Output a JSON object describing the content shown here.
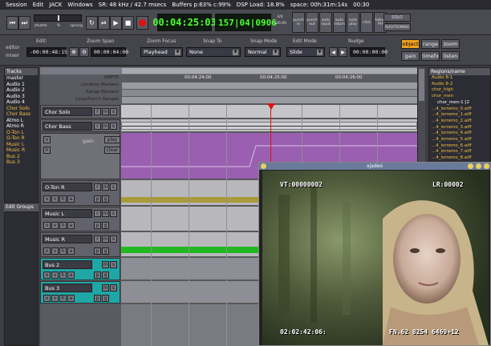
{
  "menu": [
    "Session",
    "Edit",
    "JACK",
    "Windows",
    "SR: 48 kHz / 42.7 msecs",
    "Buffers p:63% c:99%",
    "DSP Load: 18.8%",
    "space: 00h:31m:14s",
    "00:30"
  ],
  "transport": {
    "shuttle_label": "shuttle",
    "shuttle_unit": "%",
    "shuttle_mode": "sprung",
    "primary_clock": "00:04:25:03",
    "secondary_clock": "157|04|0906",
    "tempo_top": "4/4",
    "tempo_bottom": "120.00",
    "punch_in": "punch in",
    "punch_out": "punch out",
    "auto_input": "auto input",
    "auto_return": "auto return",
    "auto_play": "auto play",
    "click": "click",
    "follow_ph": "follow PH",
    "solo": "SOLO",
    "auditioning": "AUDITIONING"
  },
  "editbar": {
    "editor_label": "editor",
    "mixer_label": "mixer",
    "edit_label": "Edit:",
    "edit_value": "-00:00:48:15",
    "zoom_span_label": "Zoom Span",
    "zoom_span_value": "00:00:04:00",
    "zoom_focus_label": "Zoom Focus",
    "zoom_focus_value": "Playhead",
    "snap_to_label": "Snap To",
    "snap_to_value": "None",
    "snap_mode_label": "Snap Mode",
    "snap_mode_value": "Normal",
    "edit_mode_label": "Edit Mode",
    "edit_mode_value": "Slide",
    "nudge_label": "Nudge",
    "nudge_value": "00:00:00:00",
    "tools": [
      "object",
      "range",
      "zoom",
      "gain",
      "timefx",
      "listen"
    ]
  },
  "tracks_panel": {
    "title": "Tracks",
    "items": [
      {
        "name": "master",
        "hl": false
      },
      {
        "name": "Audio 1",
        "hl": false
      },
      {
        "name": "Audio 2",
        "hl": false
      },
      {
        "name": "Audio 3",
        "hl": false
      },
      {
        "name": "Audio 4",
        "hl": false
      },
      {
        "name": "Chor Solo",
        "hl": true
      },
      {
        "name": "Chor Bass",
        "hl": true
      },
      {
        "name": "Atmo L",
        "hl": false
      },
      {
        "name": "Atmo R",
        "hl": false
      },
      {
        "name": "O-Ton L",
        "hl": true
      },
      {
        "name": "O-Ton R",
        "hl": true
      },
      {
        "name": "Music L",
        "hl": true
      },
      {
        "name": "Music R",
        "hl": true
      },
      {
        "name": "Bus 2",
        "hl": true
      },
      {
        "name": "Bus 3",
        "hl": true
      }
    ],
    "edit_groups": "Edit Groups"
  },
  "rulers": {
    "smpte": "SMPTE",
    "location": "Location Markers",
    "range": "Range Markers",
    "loop": "Loop/Punch Ranges",
    "t1": "00:04:24:00",
    "t2": "00:04:25:00",
    "t3": "00:04:26:00"
  },
  "tracks": [
    {
      "name": "Chor Solo",
      "btns": [
        "r",
        "m",
        "s"
      ]
    },
    {
      "name": "Chor Bass",
      "btns": [
        "r",
        "m",
        "s"
      ]
    },
    {
      "name": "",
      "btns": [
        "x",
        "h"
      ],
      "gain": "gain",
      "play": "play",
      "clear": "clear"
    },
    {
      "name": "O-Ton R",
      "btns": [
        "r",
        "m",
        "s",
        "x",
        "v",
        "h",
        "a",
        "p",
        "g"
      ]
    },
    {
      "name": "Music L",
      "btns": [
        "r",
        "m",
        "s",
        "x",
        "v",
        "h",
        "a",
        "p",
        "g"
      ]
    },
    {
      "name": "Music R",
      "btns": [
        "r",
        "m",
        "s",
        "x",
        "v",
        "h",
        "a",
        "p",
        "g"
      ]
    },
    {
      "name": "Bus 2",
      "btns": [
        "m",
        "s",
        "x",
        "v",
        "h",
        "a",
        "p",
        "g"
      ]
    },
    {
      "name": "Bus 3",
      "btns": [
        "m",
        "s",
        "x",
        "v",
        "h",
        "a",
        "p",
        "g"
      ]
    }
  ],
  "regions_panel": {
    "title": "Regions/name",
    "items": [
      "Audio 8-1",
      "Audio 8-2",
      "chor_high",
      "chor_men",
      "chor_men-1 [2",
      "...4_iorremo_0.aiff",
      "...4_iorremo_1.aiff",
      "...4_iorremo_2.aiff",
      "...4_iorremo_3.aiff",
      "...4_iorremo_4.aiff",
      "...4_iorremo_5.aiff",
      "...4_iorremo_6.aiff",
      "...4_iorremo_7.aiff",
      "...4_iorremo_8.aiff"
    ]
  },
  "video": {
    "title": "xjadeo",
    "vt": "VT:00000002",
    "lr": "LR:00002",
    "tc": "02:02:42:06:",
    "fn": "FN.62 8254 6469+12"
  },
  "colors": {
    "clock_fg": "#4cff2f",
    "active_tool": "#f0a020",
    "track_highlight": "#f0c040",
    "purple_lane": "#9a5fb0",
    "teal_hdr": "#1fa7a6",
    "playhead": "#e01010"
  }
}
